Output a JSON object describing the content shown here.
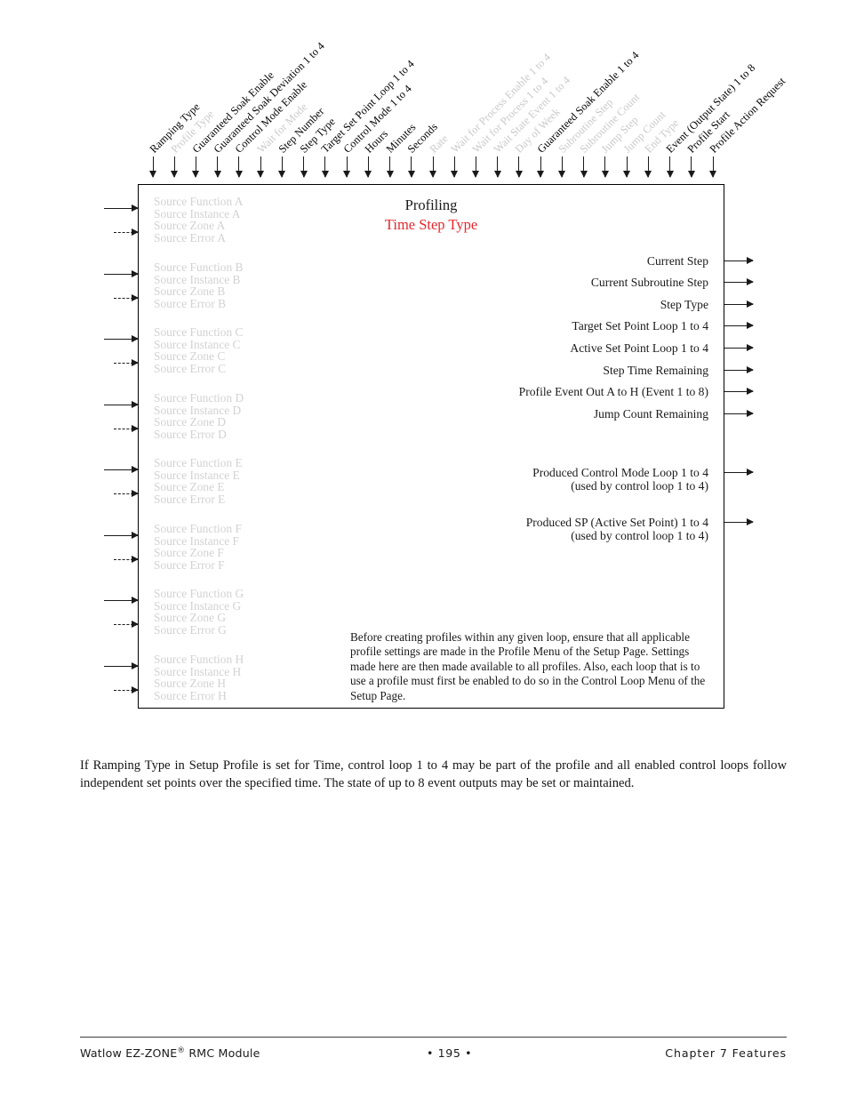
{
  "diagram": {
    "title_line1": "Profiling",
    "title_line2": "Time Step Type",
    "title_accent_color": "#e8262d",
    "inactive_color": "#c9c9c9",
    "top_inputs": [
      {
        "label": "Ramping Type",
        "active": true
      },
      {
        "label": "Profile Type",
        "active": false
      },
      {
        "label": "Guaranteed Soak Enable",
        "active": true
      },
      {
        "label": "Guaranteed Soak Deviation 1 to 4",
        "active": true
      },
      {
        "label": "Control Mode Enable",
        "active": true
      },
      {
        "label": "Wait for Mode",
        "active": false
      },
      {
        "label": "Step Number",
        "active": true
      },
      {
        "label": "Step Type",
        "active": true
      },
      {
        "label": "Target Set Point Loop 1 to 4",
        "active": true
      },
      {
        "label": "Control Mode 1 to 4",
        "active": true
      },
      {
        "label": "Hours",
        "active": true
      },
      {
        "label": "Minutes",
        "active": true
      },
      {
        "label": "Seconds",
        "active": true
      },
      {
        "label": "Rate",
        "active": false
      },
      {
        "label": "Wait for Process Enable 1 to 4",
        "active": false
      },
      {
        "label": "Wait for Process 1 to 4",
        "active": false
      },
      {
        "label": "Wait State Event 1 to 4",
        "active": false
      },
      {
        "label": "Day of Week",
        "active": false
      },
      {
        "label": "Guaranteed Soak Enable 1 to 4",
        "active": true
      },
      {
        "label": "Subroutine Step",
        "active": false
      },
      {
        "label": "Subroutine Count",
        "active": false
      },
      {
        "label": "Jump Step",
        "active": false
      },
      {
        "label": "Jump Count",
        "active": false
      },
      {
        "label": "End Type",
        "active": false
      },
      {
        "label": "Event (Output State) 1 to 8",
        "active": true
      },
      {
        "label": "Profile Start",
        "active": true
      },
      {
        "label": "Profile Action Request",
        "active": true
      }
    ],
    "left_inputs": [
      {
        "lines": [
          "Source Function A",
          "Source Instance A",
          "Source Zone A",
          "Source Error A"
        ]
      },
      {
        "lines": [
          "Source Function B",
          "Source Instance B",
          "Source Zone B",
          "Source Error B"
        ]
      },
      {
        "lines": [
          "Source Function C",
          "Source Instance C",
          "Source Zone C",
          "Source Error C"
        ]
      },
      {
        "lines": [
          "Source Function D",
          "Source Instance D",
          "Source Zone D",
          "Source Error D"
        ]
      },
      {
        "lines": [
          "Source Function E",
          "Source Instance E",
          "Source Zone E",
          "Source Error E"
        ]
      },
      {
        "lines": [
          "Source Function F",
          "Source Instance F",
          "Source Zone F",
          "Source Error F"
        ]
      },
      {
        "lines": [
          "Source Function G",
          "Source Instance G",
          "Source Zone G",
          "Source Error G"
        ]
      },
      {
        "lines": [
          "Source Function H",
          "Source Instance H",
          "Source Zone H",
          "Source Error H"
        ]
      }
    ],
    "right_outputs": [
      {
        "main": "Current Step",
        "sub": ""
      },
      {
        "main": "Current Subroutine Step",
        "sub": ""
      },
      {
        "main": "Step Type",
        "sub": ""
      },
      {
        "main": "Target Set Point Loop 1 to 4",
        "sub": ""
      },
      {
        "main": "Active Set Point Loop 1 to 4",
        "sub": ""
      },
      {
        "main": "Step Time Remaining",
        "sub": ""
      },
      {
        "main": "Profile Event Out A to H (Event 1 to 8)",
        "sub": ""
      },
      {
        "main": "Jump Count Remaining",
        "sub": ""
      },
      {
        "main": "Produced Control Mode Loop 1 to 4",
        "sub": "(used by control loop 1 to 4)"
      },
      {
        "main": "Produced SP (Active Set Point) 1 to 4",
        "sub": "(used by control loop 1 to 4)"
      }
    ],
    "note": "Before creating profiles within any given loop, ensure that all applicable profile settings are made in the Profile Menu of the Setup Page. Settings made here are then made available to all profiles. Also, each loop that is to use a profile must first be enabled to do so in the Control Loop Menu of the Setup Page."
  },
  "body": {
    "paragraph": "If Ramping Type in Setup Profile is set for Time, control loop 1 to 4 may be part of the profile and all enabled control loops follow independent set points over the specified time.  The state of up to 8 event outputs may be set or maintained."
  },
  "footer": {
    "left_pre": "Watlow EZ-ZONE",
    "left_sup": "®",
    "left_post": " RMC Module",
    "center": "•  195  •",
    "right": "Chapter 7 Features"
  }
}
